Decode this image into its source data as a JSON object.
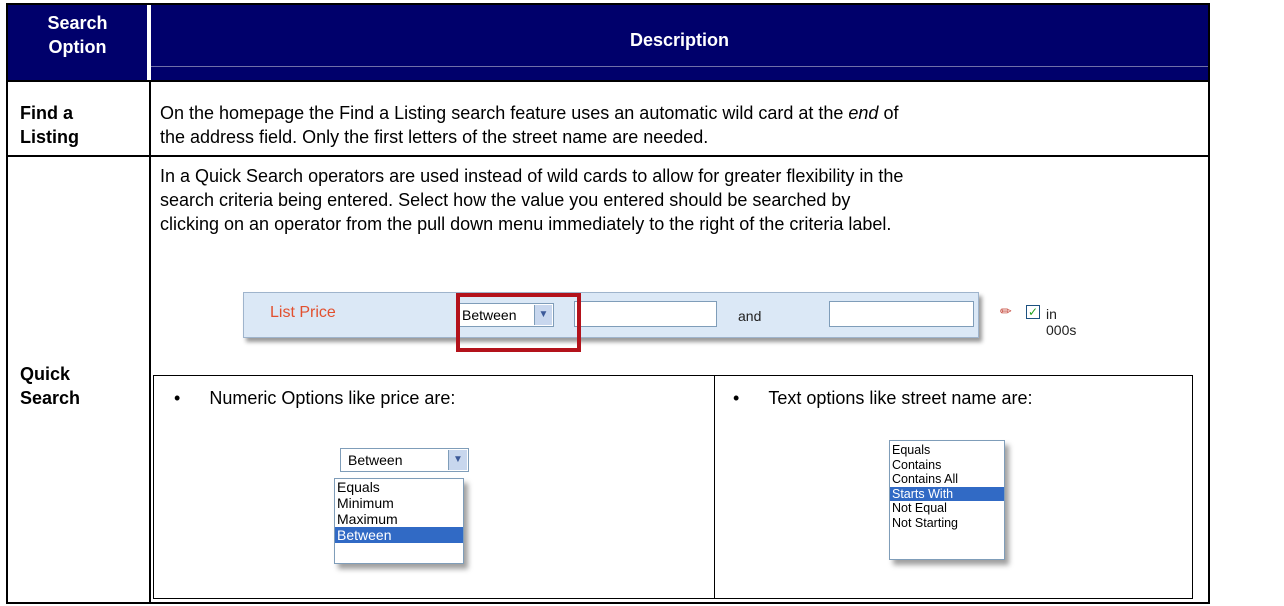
{
  "header": {
    "option_label_line1": "Search",
    "option_label_line2": "Option",
    "description_label": "Description"
  },
  "rows": {
    "find_listing": {
      "option_line1": "Find a",
      "option_line2": "Listing",
      "line1_before": "On the homepage the Find a Listing search feature uses an automatic wild card at the ",
      "line1_em": "end",
      "line1_after": " of",
      "line2": "the address field.  Only the first letters of the street name are needed."
    },
    "quick_search": {
      "option_line1": "Quick",
      "option_line2": "Search",
      "line1": "In a Quick Search operators are used instead of wild cards to allow for greater flexibility in the",
      "line2": "search criteria being entered.  Select how the value you entered should be searched by",
      "line3": "clicking on an operator from the pull down menu immediately to the right of the criteria label."
    }
  },
  "example_bar": {
    "criteria_label": "List Price",
    "operator_value": "Between",
    "and_text": "and",
    "units_label": "in 000s",
    "units_checked": true,
    "eraser_icon": "eraser-icon"
  },
  "numeric_options": {
    "bullet_text": "Numeric Options like price are:",
    "selected": "Between",
    "items": [
      "Equals",
      "Minimum",
      "Maximum",
      "Between"
    ]
  },
  "text_options": {
    "bullet_text": "Text options like street name are:",
    "selected": "Starts With",
    "items": [
      "Equals",
      "Contains",
      "Contains All",
      "Starts With",
      "Not Equal",
      "Not Starting"
    ]
  }
}
